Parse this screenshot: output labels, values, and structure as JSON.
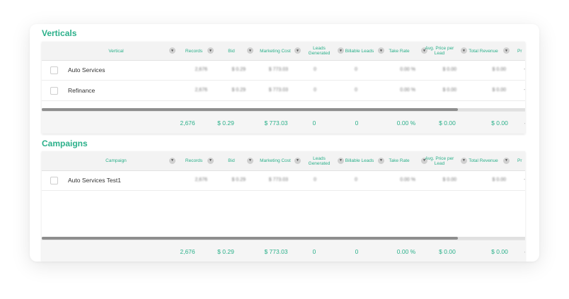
{
  "verticals": {
    "title": "Verticals",
    "columns": [
      "Vertical",
      "Records",
      "Bid",
      "Marketing Cost",
      "Leads Generated",
      "Billable Leads",
      "Take Rate",
      "Avg. Price per Lead",
      "Total Revenue",
      "Pr"
    ],
    "rows": [
      {
        "name": "Auto Services",
        "records": "2,676",
        "bid": "$ 0.29",
        "cost": "$ 773.03",
        "leads": "0",
        "billable": "0",
        "take": "0.00 %",
        "avg": "$ 0.00",
        "revenue": "$ 0.00"
      },
      {
        "name": "Refinance",
        "records": "2,676",
        "bid": "$ 0.29",
        "cost": "$ 773.03",
        "leads": "0",
        "billable": "0",
        "take": "0.00 %",
        "avg": "$ 0.00",
        "revenue": "$ 0.00"
      }
    ],
    "totals": {
      "records": "2,676",
      "bid": "$ 0.29",
      "cost": "$ 773.03",
      "leads": "0",
      "billable": "0",
      "take": "0.00 %",
      "avg": "$ 0.00",
      "revenue": "$ 0.00"
    }
  },
  "campaigns": {
    "title": "Campaigns",
    "columns": [
      "Campaign",
      "Records",
      "Bid",
      "Marketing Cost",
      "Leads Generated",
      "Billable Leads",
      "Take Rate",
      "Avg. Price per Lead",
      "Total Revenue",
      "Pr"
    ],
    "rows": [
      {
        "name": "Auto Services Test1",
        "records": "2,676",
        "bid": "$ 0.29",
        "cost": "$ 773.03",
        "leads": "0",
        "billable": "0",
        "take": "0.00 %",
        "avg": "$ 0.00",
        "revenue": "$ 0.00"
      }
    ],
    "totals": {
      "records": "2,676",
      "bid": "$ 0.29",
      "cost": "$ 773.03",
      "leads": "0",
      "billable": "0",
      "take": "0.00 %",
      "avg": "$ 0.00",
      "revenue": "$ 0.00"
    }
  },
  "icons": {
    "sort": "caret-down-icon",
    "checkbox": "checkbox-icon"
  },
  "colors": {
    "accent": "#2bb08a",
    "header_bg": "#f3f3f3",
    "scroll_thumb": "#8e8e8e"
  },
  "dash": "-"
}
